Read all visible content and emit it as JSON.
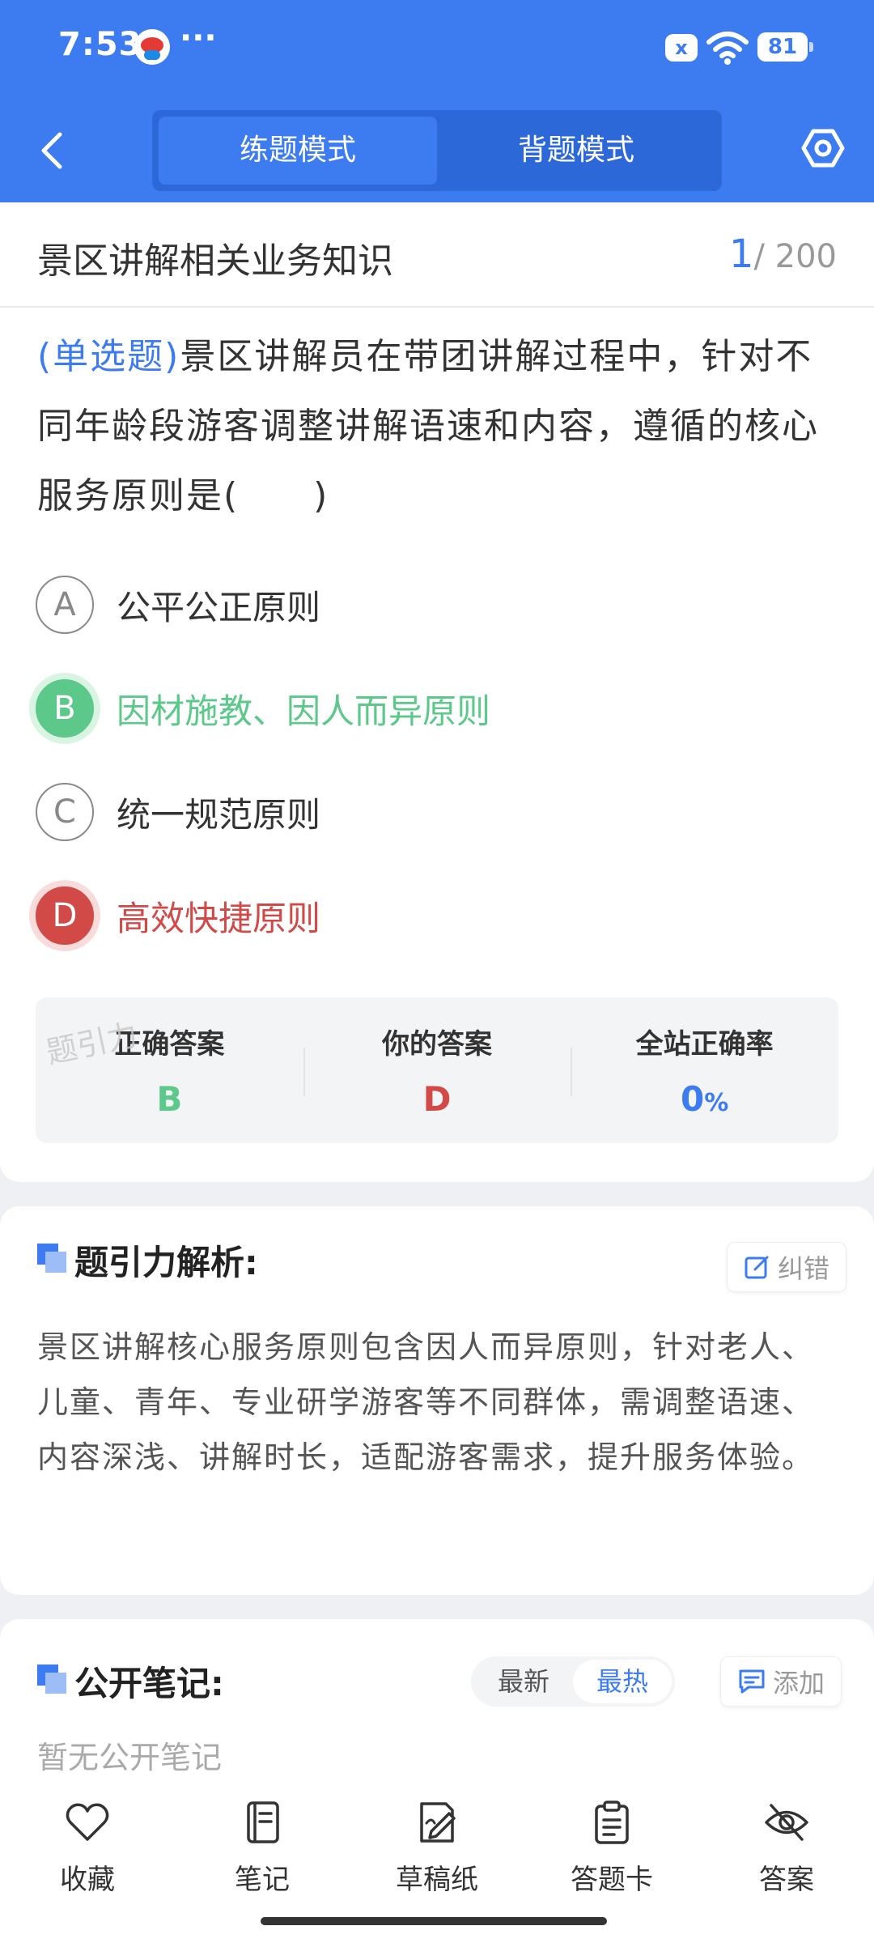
{
  "status_bar": {
    "time": "7:53",
    "dots": "···",
    "mute_icon": "x",
    "battery": "81"
  },
  "header": {
    "modes": [
      {
        "label": "练题模式",
        "active": true
      },
      {
        "label": "背题模式",
        "active": false
      }
    ],
    "accent_color": "#3d7cf0"
  },
  "question_card": {
    "section_title": "景区讲解相关业务知识",
    "progress_current": "1",
    "progress_total": "/ 200",
    "question_type": "(单选题)",
    "question_text": "景区讲解员在带团讲解过程中，针对不同年龄段游客调整讲解语速和内容，遵循的核心服务原则是(　　)",
    "options": [
      {
        "letter": "A",
        "text": "公平公正原则",
        "state": "normal"
      },
      {
        "letter": "B",
        "text": "因材施教、因人而异原则",
        "state": "correct"
      },
      {
        "letter": "C",
        "text": "统一规范原则",
        "state": "normal"
      },
      {
        "letter": "D",
        "text": "高效快捷原则",
        "state": "wrong"
      }
    ],
    "answer_summary": {
      "correct_label": "正确答案",
      "correct_value": "B",
      "yours_label": "你的答案",
      "yours_value": "D",
      "rate_label": "全站正确率",
      "rate_value": "0",
      "rate_unit": "%"
    },
    "watermark": "题引力",
    "colors": {
      "correct": "#5cc98a",
      "wrong": "#d24a47"
    }
  },
  "analysis": {
    "title": "题引力解析:",
    "report_button": "纠错",
    "text": "景区讲解核心服务原则包含因人而异原则，针对老人、儿童、青年、专业研学游客等不同群体，需调整语速、内容深浅、讲解时长，适配游客需求，提升服务体验。"
  },
  "notes": {
    "title": "公开笔记:",
    "sort_options": [
      {
        "label": "最新",
        "active": false
      },
      {
        "label": "最热",
        "active": true
      }
    ],
    "add_button": "添加",
    "empty_text": "暂无公开笔记"
  },
  "bottom_tabs": [
    {
      "label": "收藏",
      "icon": "heart-icon"
    },
    {
      "label": "笔记",
      "icon": "notebook-icon"
    },
    {
      "label": "草稿纸",
      "icon": "draft-pen-icon"
    },
    {
      "label": "答题卡",
      "icon": "clipboard-icon"
    },
    {
      "label": "答案",
      "icon": "eye-off-icon"
    }
  ]
}
